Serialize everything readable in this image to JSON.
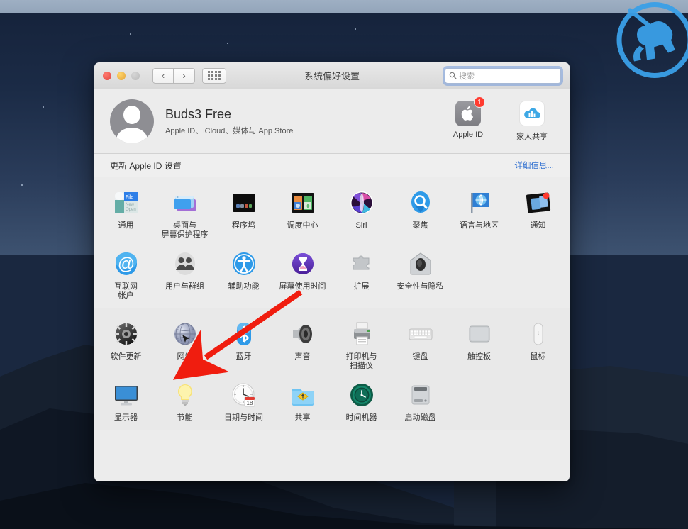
{
  "desktop": {
    "wallpaper_top_color": "#15223a",
    "wallpaper_bottom_color": "#3d5270",
    "logo_name": "knight-horse-logo",
    "logo_color": "#3aa0e8"
  },
  "window": {
    "title": "系统偏好设置",
    "traffic_lights": [
      "close",
      "minimize",
      "zoom"
    ],
    "nav": {
      "back": "‹",
      "forward": "›",
      "grid": "grid-view"
    },
    "search": {
      "placeholder": "搜索",
      "value": ""
    }
  },
  "account": {
    "name": "Buds3 Free",
    "subtitle": "Apple ID、iCloud、媒体与 App Store",
    "tiles": [
      {
        "label": "Apple ID",
        "icon": "apple-logo-icon",
        "badge": "1"
      },
      {
        "label": "家人共享",
        "icon": "icloud-family-icon",
        "badge": ""
      }
    ]
  },
  "notice": {
    "text": "更新 Apple ID 设置",
    "link": "详细信息...",
    "link_color": "#2f6fd0"
  },
  "sections": [
    {
      "id": "section-1",
      "rows": [
        [
          {
            "label": "通用",
            "icon": "general-icon"
          },
          {
            "label": "桌面与\n屏幕保护程序",
            "icon": "desktop-screensaver-icon"
          },
          {
            "label": "程序坞",
            "icon": "dock-icon"
          },
          {
            "label": "调度中心",
            "icon": "mission-control-icon"
          },
          {
            "label": "Siri",
            "icon": "siri-icon"
          },
          {
            "label": "聚焦",
            "icon": "spotlight-icon"
          },
          {
            "label": "语言与地区",
            "icon": "language-region-icon"
          },
          {
            "label": "通知",
            "icon": "notifications-icon"
          }
        ],
        [
          {
            "label": "互联网\n帐户",
            "icon": "internet-accounts-icon"
          },
          {
            "label": "用户与群组",
            "icon": "users-groups-icon"
          },
          {
            "label": "辅助功能",
            "icon": "accessibility-icon"
          },
          {
            "label": "屏幕使用时间",
            "icon": "screen-time-icon"
          },
          {
            "label": "扩展",
            "icon": "extensions-icon"
          },
          {
            "label": "安全性与隐私",
            "icon": "security-privacy-icon"
          }
        ]
      ]
    },
    {
      "id": "section-2",
      "rows": [
        [
          {
            "label": "软件更新",
            "icon": "software-update-icon"
          },
          {
            "label": "网络",
            "icon": "network-icon"
          },
          {
            "label": "蓝牙",
            "icon": "bluetooth-icon"
          },
          {
            "label": "声音",
            "icon": "sound-icon"
          },
          {
            "label": "打印机与\n扫描仪",
            "icon": "printers-scanners-icon"
          },
          {
            "label": "键盘",
            "icon": "keyboard-icon"
          },
          {
            "label": "触控板",
            "icon": "trackpad-icon"
          },
          {
            "label": "鼠标",
            "icon": "mouse-icon"
          }
        ],
        [
          {
            "label": "显示器",
            "icon": "displays-icon"
          },
          {
            "label": "节能",
            "icon": "energy-saver-icon"
          },
          {
            "label": "日期与时间",
            "icon": "date-time-icon"
          },
          {
            "label": "共享",
            "icon": "sharing-icon"
          },
          {
            "label": "时间机器",
            "icon": "time-machine-icon"
          },
          {
            "label": "启动磁盘",
            "icon": "startup-disk-icon"
          }
        ]
      ]
    }
  ],
  "annotation": {
    "arrow_color": "#f01d0f",
    "from": "screen-time-icon",
    "to": "network-icon"
  }
}
